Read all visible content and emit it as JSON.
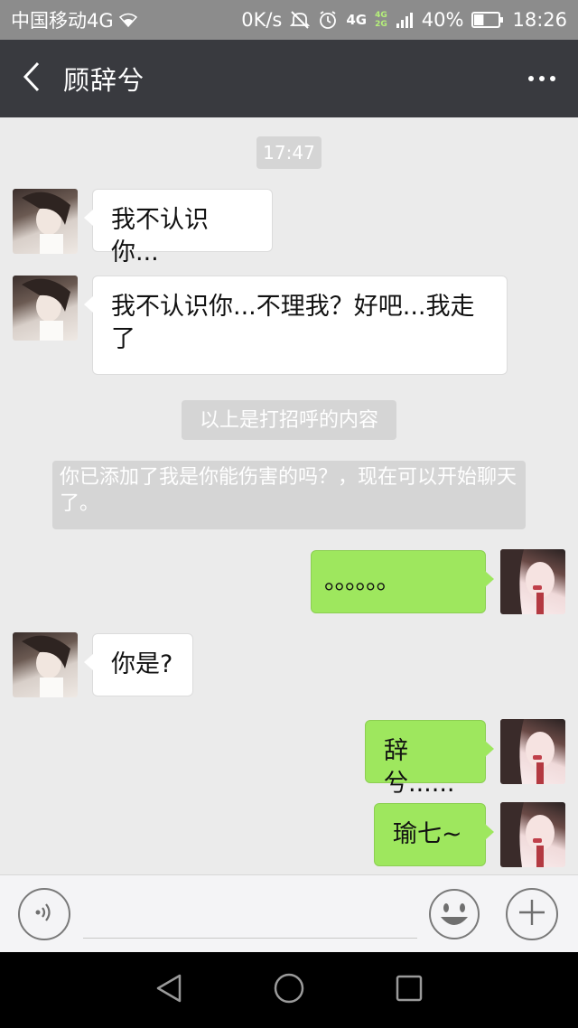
{
  "status_bar": {
    "carrier": "中国移动4G",
    "speed": "0K/s",
    "net_main": "4G",
    "net_stack_top": "4G",
    "net_stack_bottom": "2G",
    "battery_percent": "40%",
    "battery_level": 0.4,
    "time": "18:26"
  },
  "header": {
    "title": "顾辞兮"
  },
  "chat": {
    "timestamp": "17:47",
    "messages": [
      {
        "side": "in",
        "text": "我不认识你..."
      },
      {
        "side": "in",
        "text": "我不认识你...不理我？好吧...我走了"
      },
      {
        "side": "system",
        "text": "以上是打招呼的内容"
      },
      {
        "side": "system",
        "text": "你已添加了我是你能伤害的吗？，现在可以开始聊天了。"
      },
      {
        "side": "out",
        "text": "。。。。。。"
      },
      {
        "side": "in",
        "text": "你是?"
      },
      {
        "side": "out",
        "text": "辞兮......"
      },
      {
        "side": "out",
        "text": "瑜七~"
      }
    ]
  },
  "input": {
    "placeholder": ""
  },
  "colors": {
    "title_bar": "#393a3f",
    "status_bar": "#8c8c8c",
    "chat_bg": "#ebebeb",
    "bubble_out": "#9ee75e",
    "bubble_in": "#ffffff",
    "system_note": "#d5d5d5"
  },
  "icons": {
    "back": "chevron-left-icon",
    "more": "more-dots-icon",
    "voice": "voice-icon",
    "emoji": "emoji-icon",
    "plus": "plus-icon",
    "nav_back": "triangle-back-icon",
    "nav_home": "circle-home-icon",
    "nav_recent": "square-recent-icon"
  }
}
